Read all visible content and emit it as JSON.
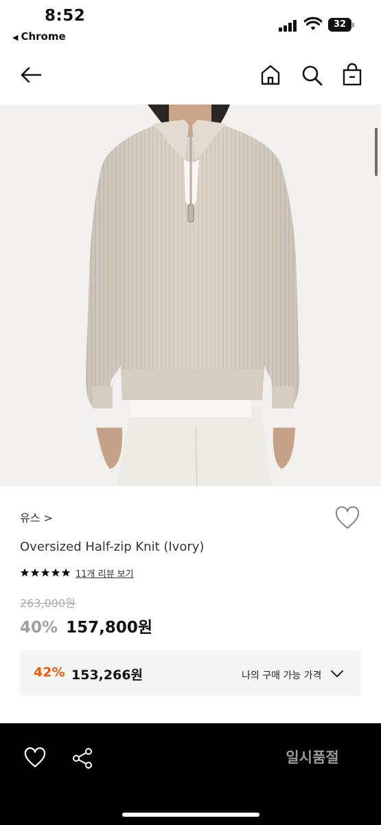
{
  "status_bar": {
    "time": "8:52",
    "back_app": "Chrome",
    "battery_level": "32"
  },
  "header": {
    "icons": [
      "back-arrow-icon",
      "home-icon",
      "search-icon",
      "shopping-bag-icon"
    ]
  },
  "product": {
    "image_alt_icon": "product-photo",
    "brand": "유스",
    "brand_chevron": ">",
    "title": "Oversized Half-zip Knit (Ivory)",
    "rating_stars": 5,
    "review_link": "11개 리뷰 보기",
    "original_price": "263,000원",
    "discount_rate": "40%",
    "sale_price": "157,800원"
  },
  "member_price": {
    "discount_rate": "42%",
    "price": "153,266원",
    "label": "나의 구매 가능 가격"
  },
  "bottom_bar": {
    "icons": [
      "heart-icon",
      "share-icon"
    ],
    "soldout_label": "일시품절"
  },
  "colors": {
    "accent_orange": "#f25c05",
    "bottom_bar_bg": "#000000",
    "knit_ivory": "#ded6cb"
  }
}
